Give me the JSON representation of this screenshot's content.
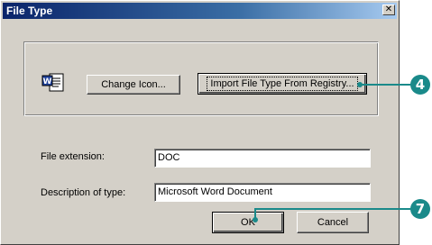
{
  "dialog": {
    "title": "File Type",
    "close_glyph": "✕"
  },
  "icon_group": {
    "icon": "word-document-icon",
    "change_icon_label": "Change Icon...",
    "import_label": "Import File Type From Registry..."
  },
  "form": {
    "extension_label": "File extension:",
    "extension_value": "DOC",
    "description_label": "Description of type:",
    "description_value": "Microsoft Word Document"
  },
  "buttons": {
    "ok_label": "OK",
    "cancel_label": "Cancel"
  },
  "callouts": [
    {
      "number": "4"
    },
    {
      "number": "7"
    }
  ],
  "colors": {
    "title_bar": "#0a246a",
    "dialog_face": "#d4d0c8",
    "callout": "#1a8a8a"
  }
}
